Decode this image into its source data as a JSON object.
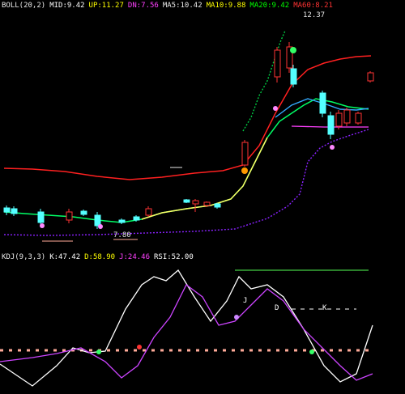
{
  "main": {
    "header": [
      {
        "text": "BOLL(20,2)",
        "color": "#e8e8e8"
      },
      {
        "text": "MID:9.42",
        "color": "#ffffff"
      },
      {
        "text": "UP:11.27",
        "color": "#ffff00"
      },
      {
        "text": "DN:7.56",
        "color": "#ff40ff"
      },
      {
        "text": "MA5:10.42",
        "color": "#e8e8e8"
      },
      {
        "text": "MA10:9.88",
        "color": "#ffff00"
      },
      {
        "text": "MA20:9.42",
        "color": "#00ff00"
      },
      {
        "text": "MA60:8.21",
        "color": "#ff3333"
      }
    ],
    "price_min_label": "7.80",
    "price_max_label": "12.37"
  },
  "osc": {
    "header": [
      {
        "text": "KDJ(9,3,3)",
        "color": "#e8e8e8"
      },
      {
        "text": "K:47.42",
        "color": "#ffffff"
      },
      {
        "text": "D:58.90",
        "color": "#ffff00"
      },
      {
        "text": "J:24.46",
        "color": "#ff40ff"
      },
      {
        "text": "RSI:52.00",
        "color": "#ffffff"
      }
    ],
    "marker_labels": [
      "J",
      "D",
      "K"
    ]
  },
  "colors": {
    "up": "#ff3333",
    "down": "#54ffff",
    "ma_long": "#ff2020",
    "ma_mid": "#00ff66",
    "band": "#8a22ff",
    "guide": "#ffaa99"
  }
}
